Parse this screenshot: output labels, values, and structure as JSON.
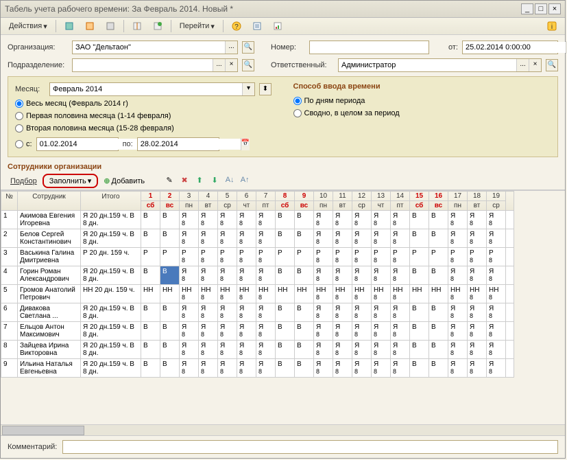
{
  "window": {
    "title": "Табель учета рабочего времени: За Февраль 2014. Новый *"
  },
  "toolbar": {
    "actions": "Действия",
    "goto": "Перейти"
  },
  "form": {
    "org_label": "Организация:",
    "org_value": "ЗАО \"Дельтаон\"",
    "dept_label": "Подразделение:",
    "dept_value": "",
    "num_label": "Номер:",
    "num_value": "",
    "from_label": "от:",
    "from_value": "25.02.2014 0:00:00",
    "resp_label": "Ответственный:",
    "resp_value": "Администратор"
  },
  "panel": {
    "month_label": "Месяц:",
    "month_value": "Февраль 2014",
    "r_full": "Весь месяц (Февраль 2014 г)",
    "r_first": "Первая половина месяца (1-14 февраля)",
    "r_second": "Вторая половина месяца (15-28 февраля)",
    "r_from": "с:",
    "date_from": "01.02.2014",
    "date_to_label": "по:",
    "date_to": "28.02.2014",
    "mode_title": "Способ ввода времени",
    "r_bydays": "По дням периода",
    "r_summary": "Сводно, в целом за период"
  },
  "section": {
    "title": "Сотрудники организации"
  },
  "grid_toolbar": {
    "select": "Подбор",
    "fill": "Заполнить",
    "add": "Добавить"
  },
  "columns": {
    "num": "№",
    "employee": "Сотрудник",
    "total": "Итого"
  },
  "days": [
    {
      "n": "1",
      "a": "сб",
      "w": true
    },
    {
      "n": "2",
      "a": "вс",
      "w": true
    },
    {
      "n": "3",
      "a": "пн",
      "w": false
    },
    {
      "n": "4",
      "a": "вт",
      "w": false
    },
    {
      "n": "5",
      "a": "ср",
      "w": false
    },
    {
      "n": "6",
      "a": "чт",
      "w": false
    },
    {
      "n": "7",
      "a": "пт",
      "w": false
    },
    {
      "n": "8",
      "a": "сб",
      "w": true
    },
    {
      "n": "9",
      "a": "вс",
      "w": true
    },
    {
      "n": "10",
      "a": "пн",
      "w": false
    },
    {
      "n": "11",
      "a": "вт",
      "w": false
    },
    {
      "n": "12",
      "a": "ср",
      "w": false
    },
    {
      "n": "13",
      "a": "чт",
      "w": false
    },
    {
      "n": "14",
      "a": "пт",
      "w": false
    },
    {
      "n": "15",
      "a": "сб",
      "w": true
    },
    {
      "n": "16",
      "a": "вс",
      "w": true
    },
    {
      "n": "17",
      "a": "пн",
      "w": false
    },
    {
      "n": "18",
      "a": "вт",
      "w": false
    },
    {
      "n": "19",
      "a": "ср",
      "w": false
    }
  ],
  "rows": [
    {
      "n": 1,
      "name": "Акимова Евгения Игоревна",
      "total": "Я 20 дн.159 ч. В 8 дн.",
      "code": "Я",
      "wk": "В",
      "sub": "8"
    },
    {
      "n": 2,
      "name": "Белов Сергей Константинович",
      "total": "Я 20 дн.159 ч. В 8 дн.",
      "code": "Я",
      "wk": "В",
      "sub": "8"
    },
    {
      "n": 3,
      "name": "Васькина Галина Дмитриевна",
      "total": "Р 20 дн. 159 ч.",
      "code": "Р",
      "wk": "Р",
      "sub": "8"
    },
    {
      "n": 4,
      "name": "Горин Роман Александрович",
      "total": "Я 20 дн.159 ч. В 8 дн.",
      "code": "Я",
      "wk": "В",
      "sub": "8",
      "sel": 2
    },
    {
      "n": 5,
      "name": "Громов Анатолий Петрович",
      "total": "НН 20 дн. 159 ч.",
      "code": "НН",
      "wk": "НН",
      "sub": "8"
    },
    {
      "n": 6,
      "name": "Дивакова Светлана ...",
      "total": "Я 20 дн.159 ч. В 8 дн.",
      "code": "Я",
      "wk": "В",
      "sub": "8"
    },
    {
      "n": 7,
      "name": "Ельцов Антон Максимович",
      "total": "Я 20 дн.159 ч. В 8 дн.",
      "code": "Я",
      "wk": "В",
      "sub": "8"
    },
    {
      "n": 8,
      "name": "Зайцева Ирина Викторовна",
      "total": "Я 20 дн.159 ч. В 8 дн.",
      "code": "Я",
      "wk": "В",
      "sub": "8"
    },
    {
      "n": 9,
      "name": "Ильина Наталья Евгеньевна",
      "total": "Я 20 дн.159 ч. В 8 дн.",
      "code": "Я",
      "wk": "В",
      "sub": "8"
    }
  ],
  "footer": {
    "comment_label": "Комментарий:",
    "comment_value": ""
  }
}
